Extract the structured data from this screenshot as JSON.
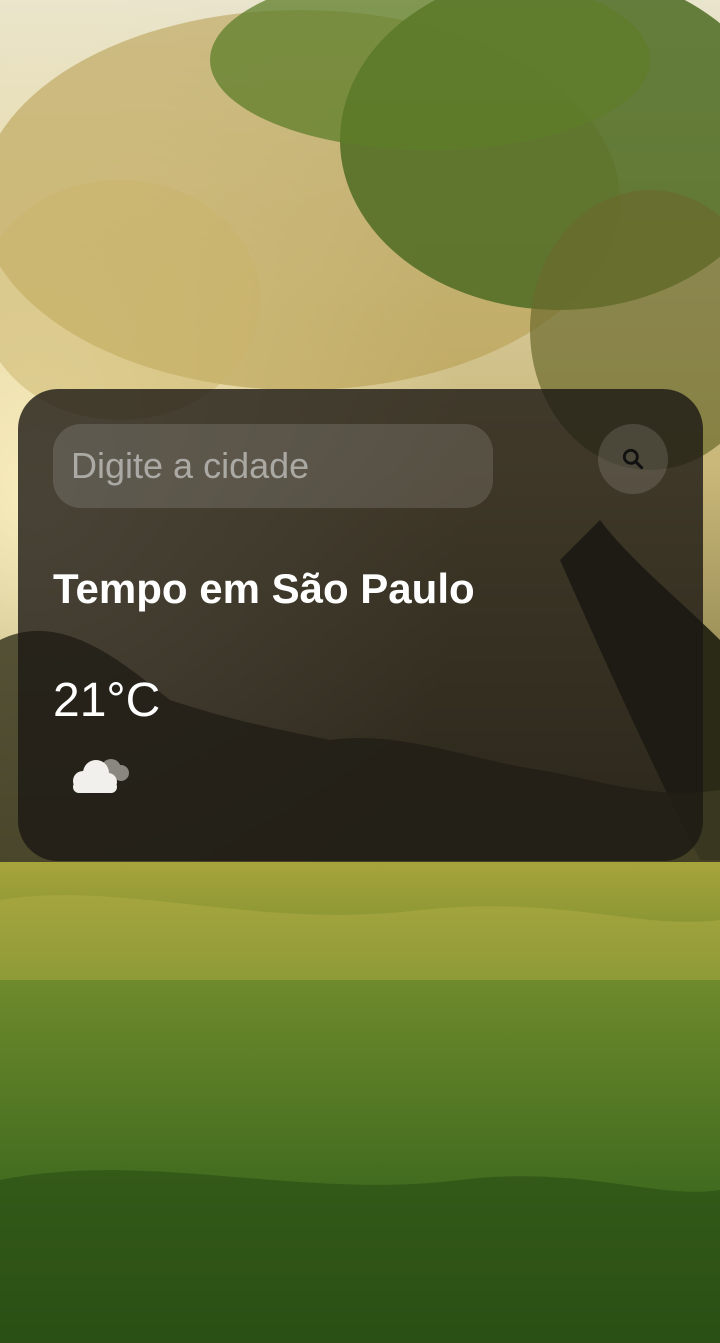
{
  "search": {
    "placeholder": "Digite a cidade",
    "button_icon": "search-icon"
  },
  "weather": {
    "title": "Tempo em São Paulo",
    "temperature": "21°C",
    "condition_icon": "cloudy-icon"
  },
  "colors": {
    "card_background": "#1c1814",
    "text": "#ffffff",
    "placeholder": "#dcdcdc"
  }
}
